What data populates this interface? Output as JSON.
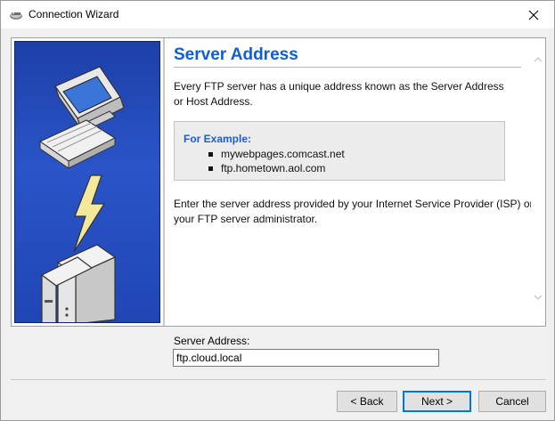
{
  "window": {
    "title": "Connection Wizard",
    "app_icon": "connection-wizard-icon",
    "close_icon": "close-icon"
  },
  "page": {
    "heading": "Server Address",
    "intro": "Every FTP server has a unique address known as the Server Address or Host Address.",
    "example": {
      "title": "For Example:",
      "items": [
        "mywebpages.comcast.net",
        "ftp.hometown.aol.com"
      ]
    },
    "outro": "Enter the server address provided by your Internet Service Provider (ISP) or your FTP server administrator."
  },
  "form": {
    "address_label": "Server Address:",
    "address_value": "ftp.cloud.local"
  },
  "buttons": {
    "back": "< Back",
    "next": "Next >",
    "cancel": "Cancel"
  },
  "colors": {
    "heading": "#0f5ed8",
    "side_panel": "#2a54c8",
    "default_button_border": "#0078d7"
  }
}
